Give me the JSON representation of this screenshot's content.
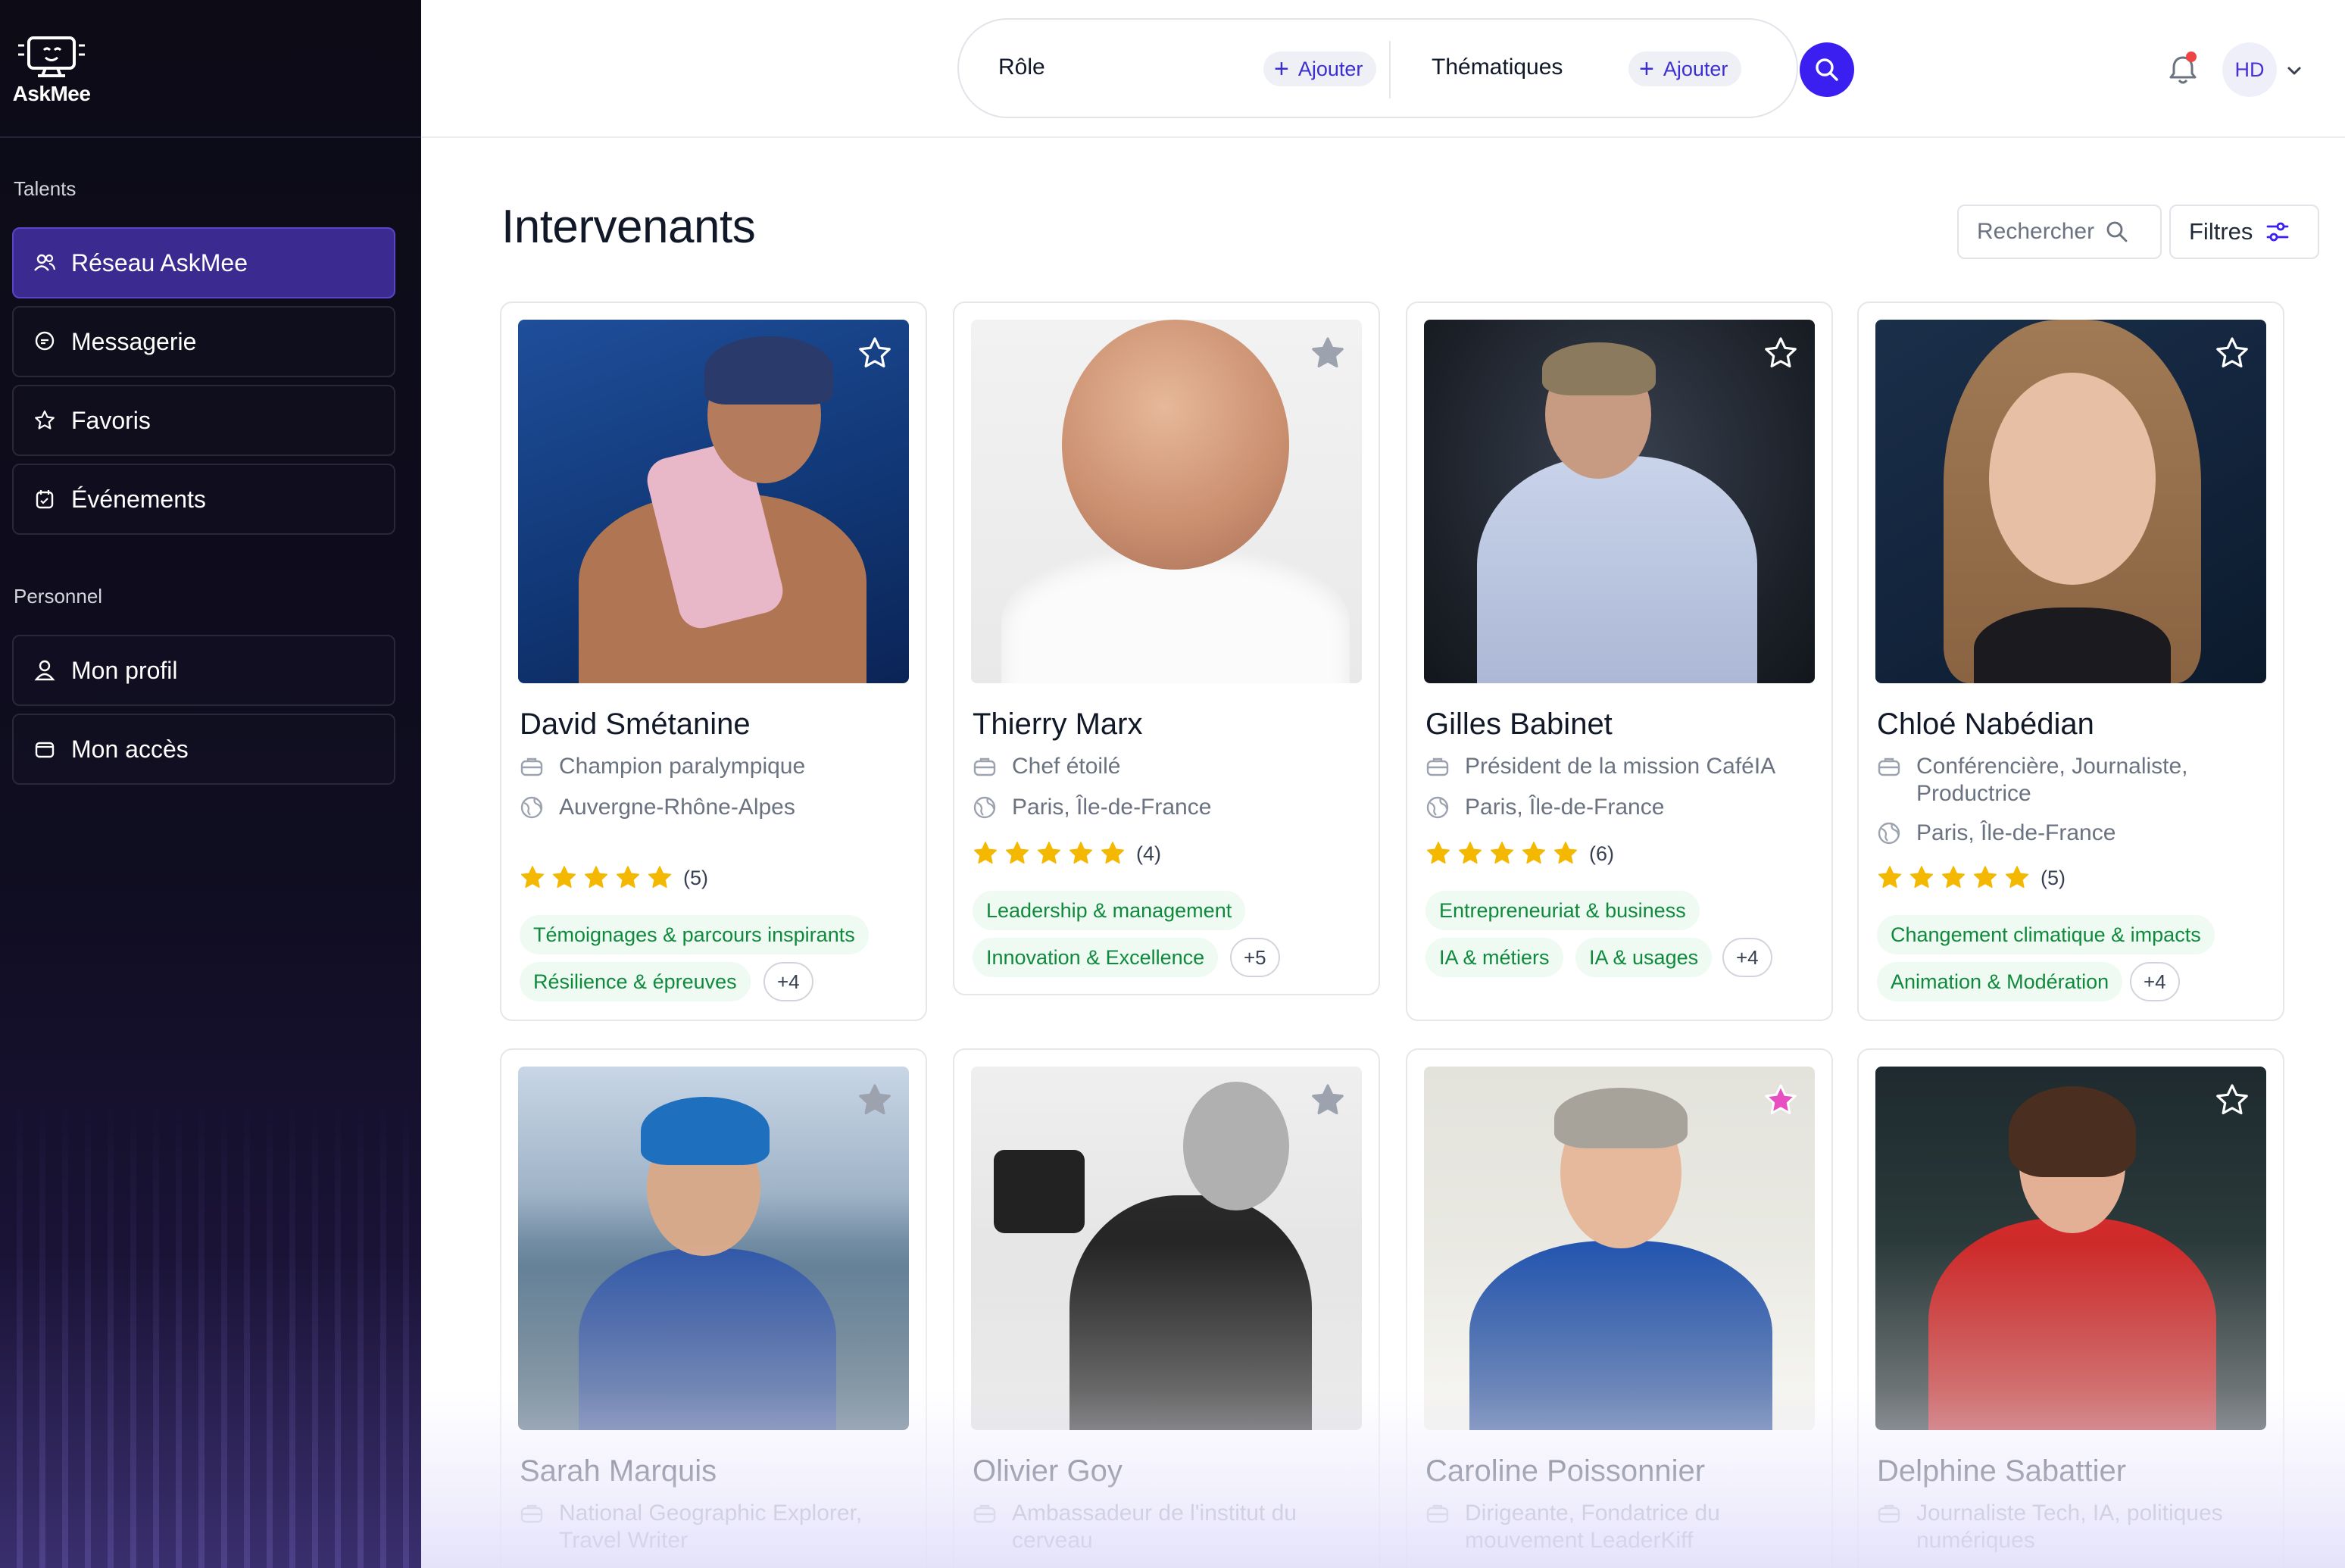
{
  "app": {
    "name": "AskMee"
  },
  "sidebar": {
    "section_talents": "Talents",
    "section_personnel": "Personnel",
    "items": [
      {
        "label": "Réseau AskMee",
        "icon": "users-icon",
        "active": true
      },
      {
        "label": "Messagerie",
        "icon": "chat-icon",
        "active": false
      },
      {
        "label": "Favoris",
        "icon": "star-icon",
        "active": false
      },
      {
        "label": "Événements",
        "icon": "calendar-icon",
        "active": false
      },
      {
        "label": "Mon profil",
        "icon": "user-icon",
        "active": false
      },
      {
        "label": "Mon accès",
        "icon": "wallet-icon",
        "active": false
      }
    ]
  },
  "topbar": {
    "role_label": "Rôle",
    "role_add": "Ajouter",
    "themes_label": "Thématiques",
    "themes_add": "Ajouter",
    "avatar_initials": "HD"
  },
  "main": {
    "title": "Intervenants",
    "search_placeholder": "Rechercher",
    "filters_label": "Filtres"
  },
  "speakers": [
    {
      "name": "David Smétanine",
      "role": "Champion paralympique",
      "location": "Auvergne-Rhône-Alpes",
      "stars": 5,
      "rating_count": "(5)",
      "tags": [
        "Témoignages & parcours inspirants",
        "Résilience & épreuves"
      ],
      "more": "+4",
      "favorite": false
    },
    {
      "name": "Thierry Marx",
      "role": "Chef étoilé",
      "location": "Paris, Île-de-France",
      "stars": 5,
      "rating_count": "(4)",
      "tags": [
        "Leadership & management",
        "Innovation & Excellence"
      ],
      "more": "+5",
      "favorite": false
    },
    {
      "name": "Gilles Babinet",
      "role": "Président de la mission CaféIA",
      "location": "Paris, Île-de-France",
      "stars": 5,
      "rating_count": "(6)",
      "tags": [
        "Entrepreneuriat & business",
        "IA & métiers",
        "IA & usages"
      ],
      "more": "+4",
      "favorite": false
    },
    {
      "name": "Chloé Nabédian",
      "role": "Conférencière, Journaliste, Productrice",
      "location": "Paris, Île-de-France",
      "stars": 5,
      "rating_count": "(5)",
      "tags": [
        "Changement climatique & impacts",
        "Animation & Modération"
      ],
      "more": "+4",
      "favorite": false
    },
    {
      "name": "Sarah Marquis",
      "role": "National Geographic Explorer, Travel Writer",
      "favorite": false
    },
    {
      "name": "Olivier Goy",
      "role": "Ambassadeur de l'institut du cerveau",
      "favorite": false
    },
    {
      "name": "Caroline Poissonnier",
      "role": "Dirigeante, Fondatrice du mouvement LeaderKiff",
      "favorite": true
    },
    {
      "name": "Delphine Sabattier",
      "role": "Journaliste Tech, IA, politiques numériques",
      "favorite": false
    }
  ],
  "colors": {
    "accent": "#3a1ff0",
    "sidebar_active": "#3b2a8f",
    "tag_bg": "#eefaf2",
    "tag_text": "#0f8a3c",
    "star": "#f5b800",
    "favorite_active": "#e84fc0"
  }
}
